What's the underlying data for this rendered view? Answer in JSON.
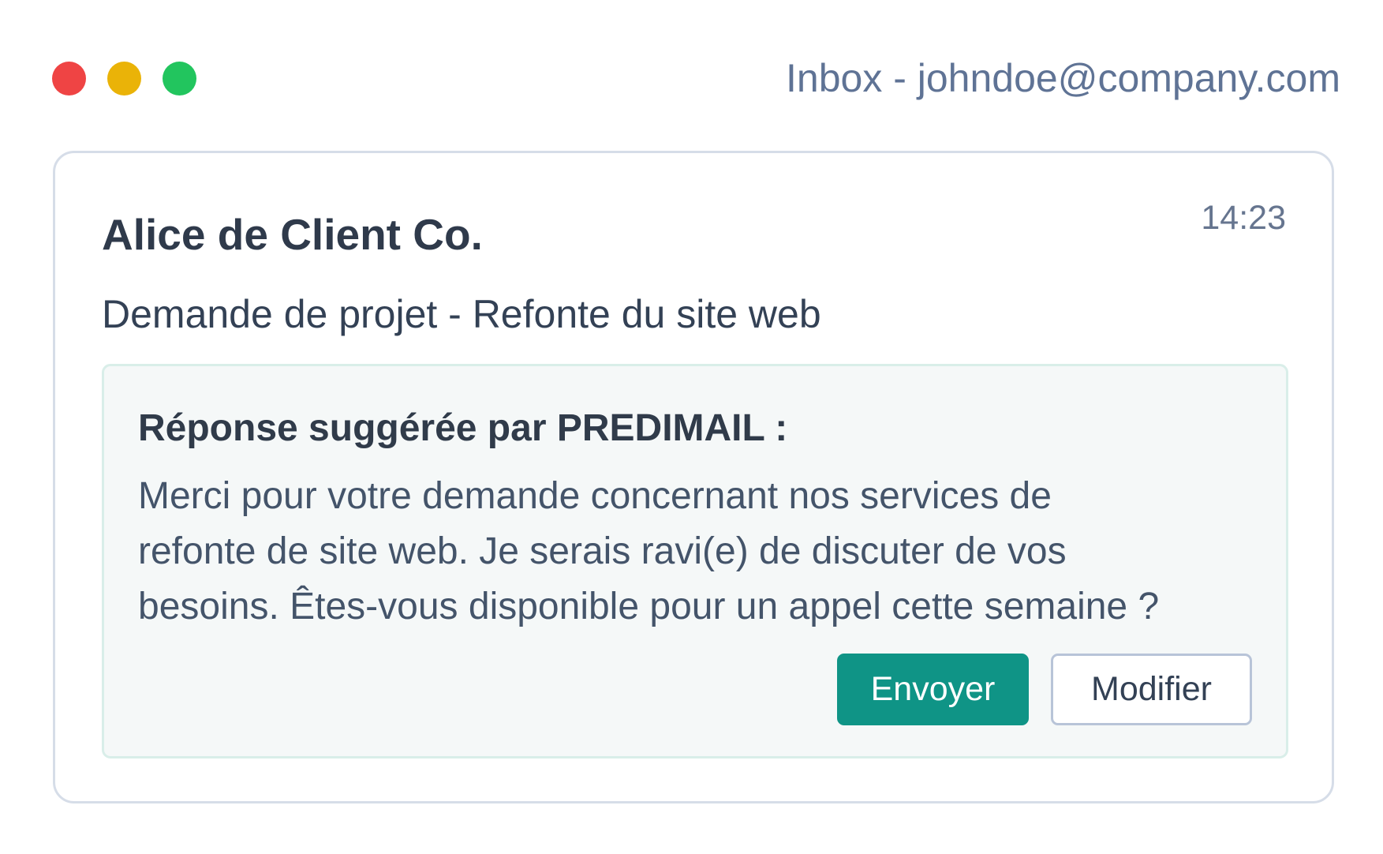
{
  "window": {
    "title": "Inbox - johndoe@company.com",
    "controls": [
      {
        "name": "close",
        "color": "#ef4444"
      },
      {
        "name": "minimize",
        "color": "#eab308"
      },
      {
        "name": "maximize",
        "color": "#22c55e"
      }
    ]
  },
  "email": {
    "sender": "Alice de Client Co.",
    "time": "14:23",
    "subject": "Demande de projet - Refonte du site web"
  },
  "suggestion": {
    "heading": "Réponse suggérée par PREDIMAIL :",
    "lines": [
      "Merci pour votre demande concernant nos services de",
      "refonte de site web. Je serais ravi(e) de discuter de vos",
      "besoins. Êtes-vous disponible pour un appel cette semaine ?"
    ],
    "send_label": "Envoyer",
    "edit_label": "Modifier"
  },
  "colors": {
    "accent": "#0f9486",
    "title_text": "#5f7395",
    "card_border": "#d6dde8",
    "suggestion_background": "#f5f8f8"
  }
}
